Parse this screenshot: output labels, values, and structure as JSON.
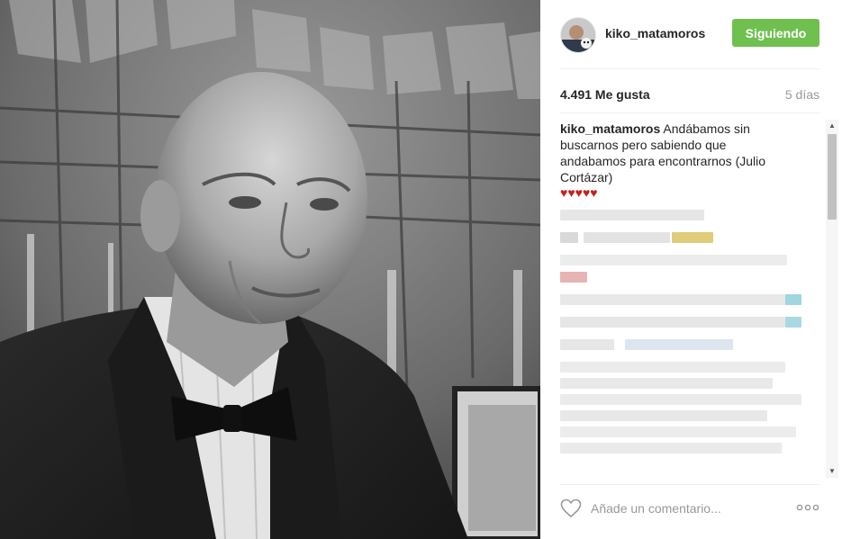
{
  "post": {
    "username": "kiko_matamoros",
    "follow_label": "Siguiendo",
    "likes": "4.491 Me gusta",
    "time_ago": "5 días"
  },
  "caption": {
    "author": "kiko_matamoros",
    "text": "Andábamos sin buscarnos pero sabiendo que andabamos para encontrarnos (Julio Cortázar)",
    "hearts": "♥♥♥♥♥"
  },
  "comment_bar": {
    "placeholder": "Añade un comentario...",
    "more": "ooo"
  },
  "icons": {
    "like": "heart-outline-icon",
    "more": "ellipsis-icon",
    "scroll_up": "arrow-up-icon",
    "scroll_down": "arrow-down-icon"
  },
  "colors": {
    "follow_button": "#70c050",
    "hearts": "#c0231f",
    "muted_text": "#999999"
  }
}
